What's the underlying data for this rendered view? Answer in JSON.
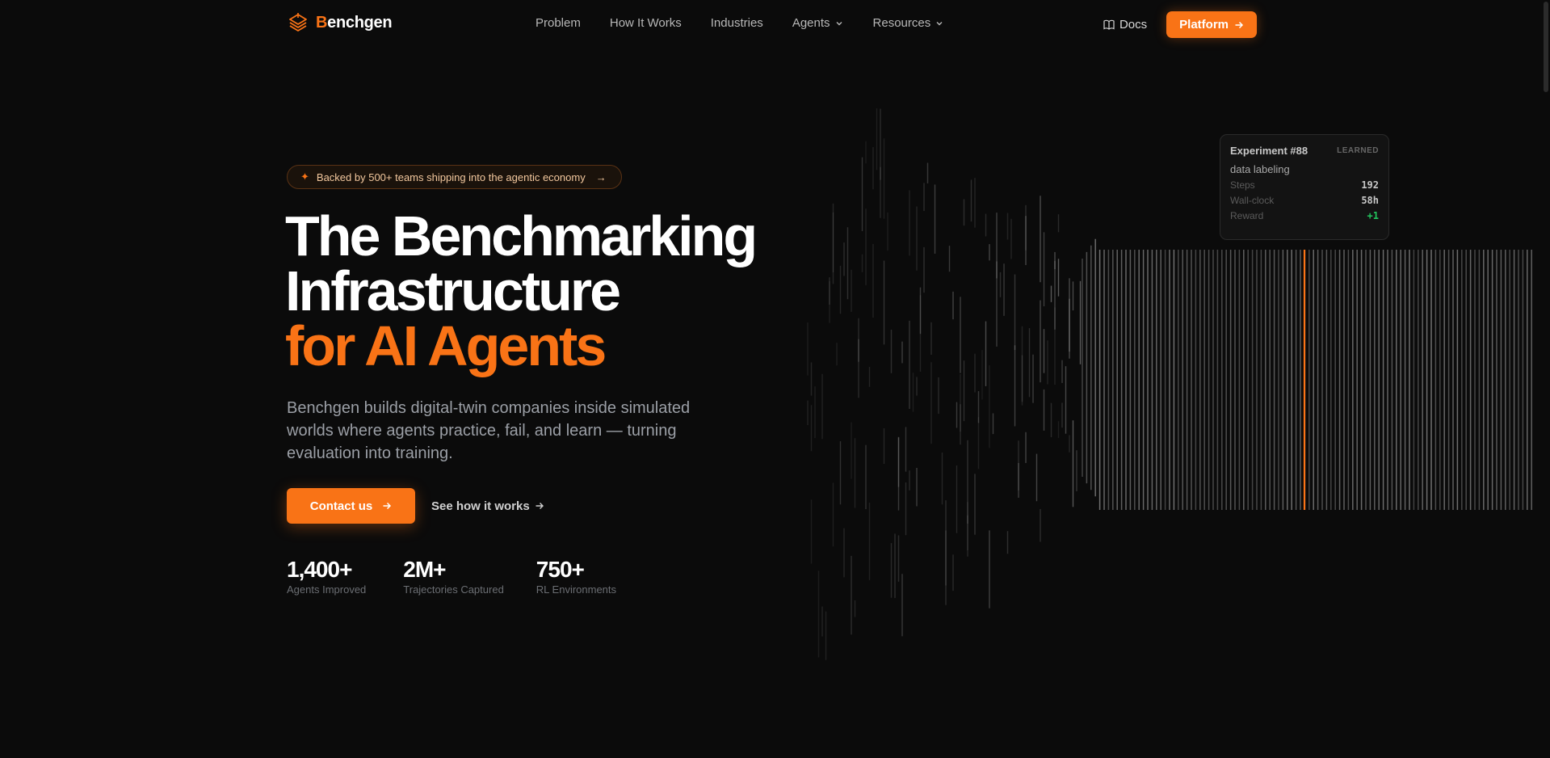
{
  "nav": {
    "brand_initial": "B",
    "brand_rest": "enchgen",
    "links": [
      {
        "label": "Problem",
        "dropdown": false
      },
      {
        "label": "How It Works",
        "dropdown": false
      },
      {
        "label": "Industries",
        "dropdown": false
      },
      {
        "label": "Agents",
        "dropdown": true
      },
      {
        "label": "Resources",
        "dropdown": true
      }
    ],
    "docs_label": "Docs",
    "platform_label": "Platform"
  },
  "hero": {
    "badge_text": "Backed by 500+ teams shipping into the agentic economy",
    "title_line1": "The Benchmarking",
    "title_line2": "Infrastructure",
    "title_line3": "for AI Agents",
    "description": "Benchgen builds digital-twin companies inside simulated worlds where agents practice, fail, and learn — turning evaluation into training.",
    "contact_label": "Contact us",
    "see_how_label": "See how it works",
    "stats": [
      {
        "value": "1,400+",
        "label": "Agents Improved"
      },
      {
        "value": "2M+",
        "label": "Trajectories Captured"
      },
      {
        "value": "750+",
        "label": "RL Environments"
      }
    ]
  },
  "experiment": {
    "title": "Experiment #88",
    "tag": "LEARNED",
    "subtitle": "data labeling",
    "rows": [
      {
        "key": "Steps",
        "value": "192"
      },
      {
        "key": "Wall-clock",
        "value": "58h"
      },
      {
        "key": "Reward",
        "value": "+1"
      }
    ]
  },
  "colors": {
    "accent": "#f97316",
    "background": "#0b0b0b",
    "success": "#22c55e"
  }
}
